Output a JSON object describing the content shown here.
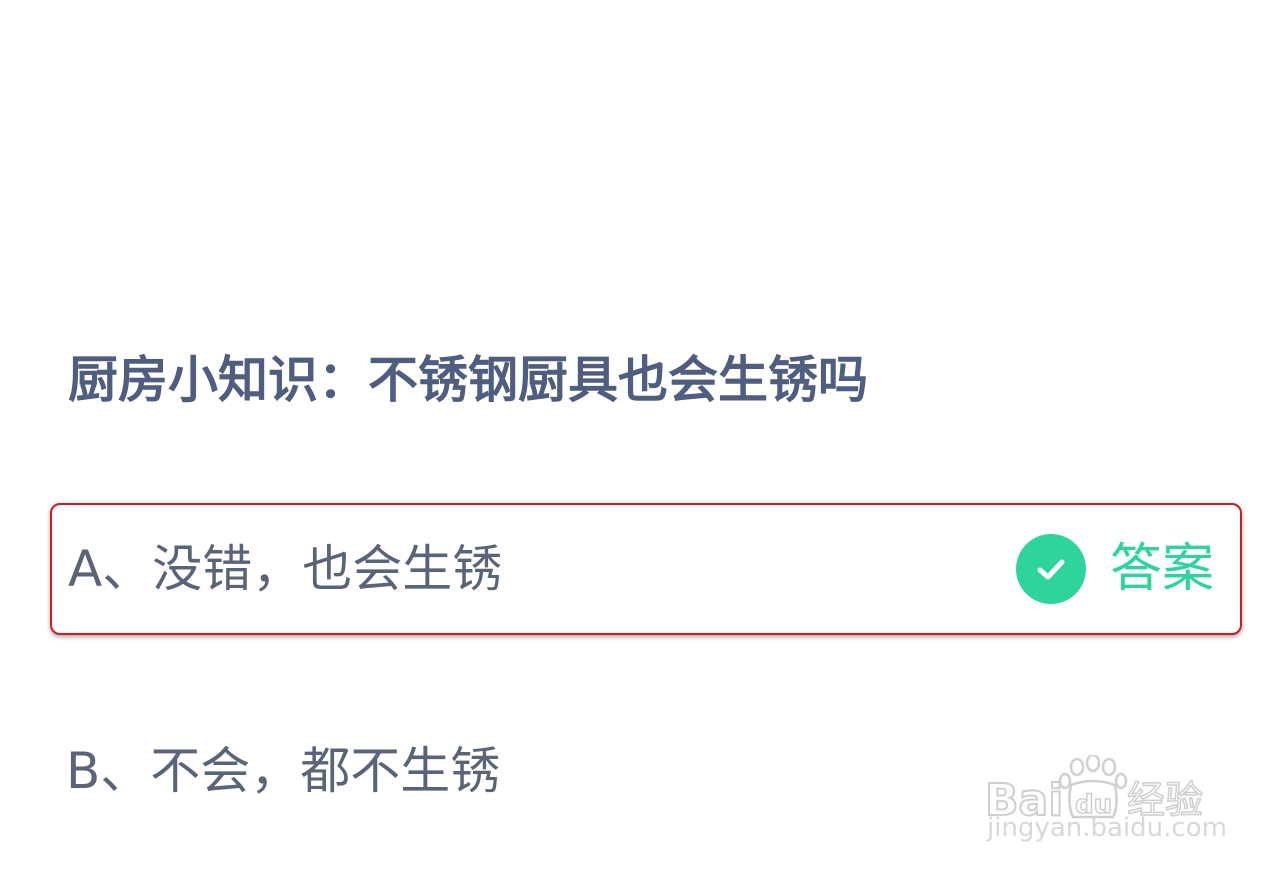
{
  "question": {
    "title": "厨房小知识：不锈钢厨具也会生锈吗"
  },
  "options": [
    {
      "label": "A、没错，也会生锈",
      "is_answer": true,
      "answer_tag": "答案"
    },
    {
      "label": "B、不会，都不生锈",
      "is_answer": false
    }
  ],
  "colors": {
    "title": "#4e5d80",
    "option_text": "#5a6478",
    "answer_accent": "#2fd39c",
    "highlight_border": "#d41b20"
  },
  "icons": {
    "answer_check": "check-circle-icon"
  },
  "watermark": {
    "logo_text": "Bai du 经验",
    "url": "jingyan.baidu.com"
  }
}
